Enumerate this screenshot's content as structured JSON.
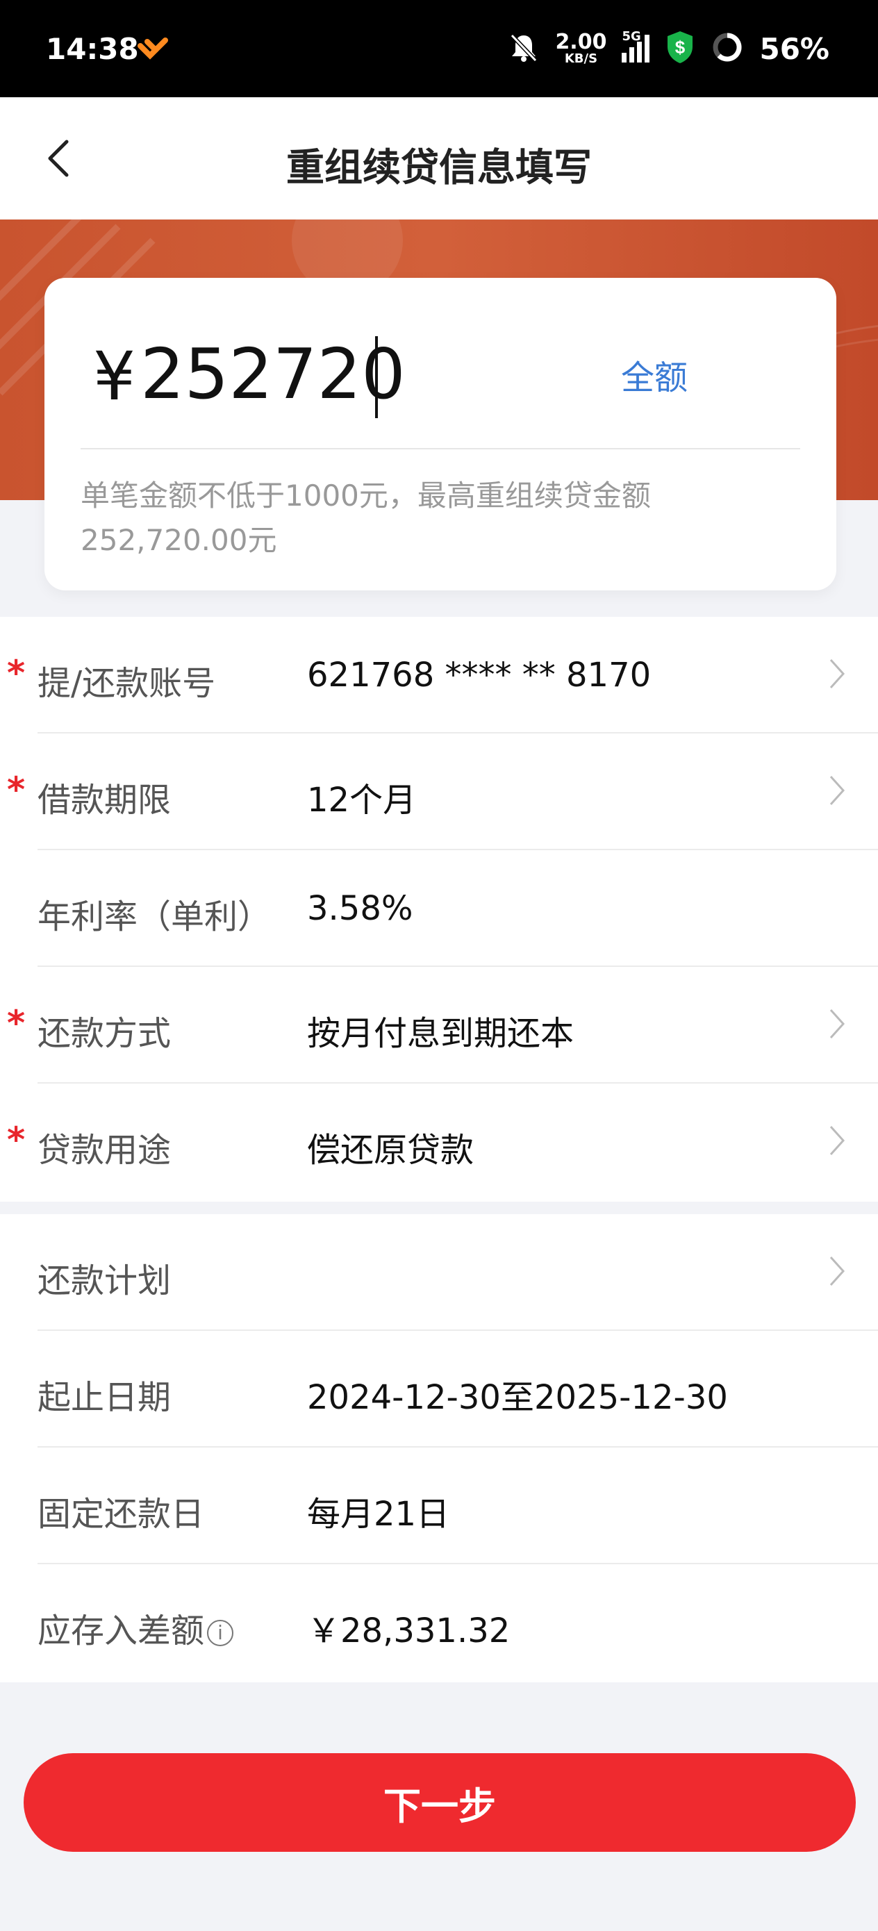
{
  "status_bar": {
    "time": "14:38",
    "net_speed": "2.00",
    "net_unit": "KB/S",
    "network": "5G",
    "battery": "56%"
  },
  "header": {
    "title": "重组续贷信息填写"
  },
  "amount": {
    "currency_symbol": "¥",
    "value": "252720",
    "full_amount_label": "全额",
    "hint": "单笔金额不低于1000元，最高重组续贷金额252,720.00元"
  },
  "form": {
    "rows": [
      {
        "label": "提/还款账号",
        "value": "621768 **** ** 8170",
        "required": true,
        "chevron": true
      },
      {
        "label": "借款期限",
        "value": "12个月",
        "required": true,
        "chevron": true
      },
      {
        "label": "年利率（单利）",
        "value": "3.58%",
        "required": false,
        "chevron": false
      },
      {
        "label": "还款方式",
        "value": "按月付息到期还本",
        "required": true,
        "chevron": true
      },
      {
        "label": "贷款用途",
        "value": "偿还原贷款",
        "required": true,
        "chevron": true
      }
    ]
  },
  "plan": {
    "rows": [
      {
        "label": "还款计划",
        "value": "",
        "chevron": true
      },
      {
        "label": "起止日期",
        "value": "2024-12-30至2025-12-30"
      },
      {
        "label": "固定还款日",
        "value": "每月21日"
      },
      {
        "label": "应存入差额",
        "value": "￥28,331.32",
        "info_icon": "i"
      }
    ]
  },
  "next_button": "下一步",
  "colors": {
    "primary_red": "#ef2a2f",
    "banner": "#c9542f",
    "link_blue": "#3a7bd5",
    "required_star": "#e8262c"
  }
}
